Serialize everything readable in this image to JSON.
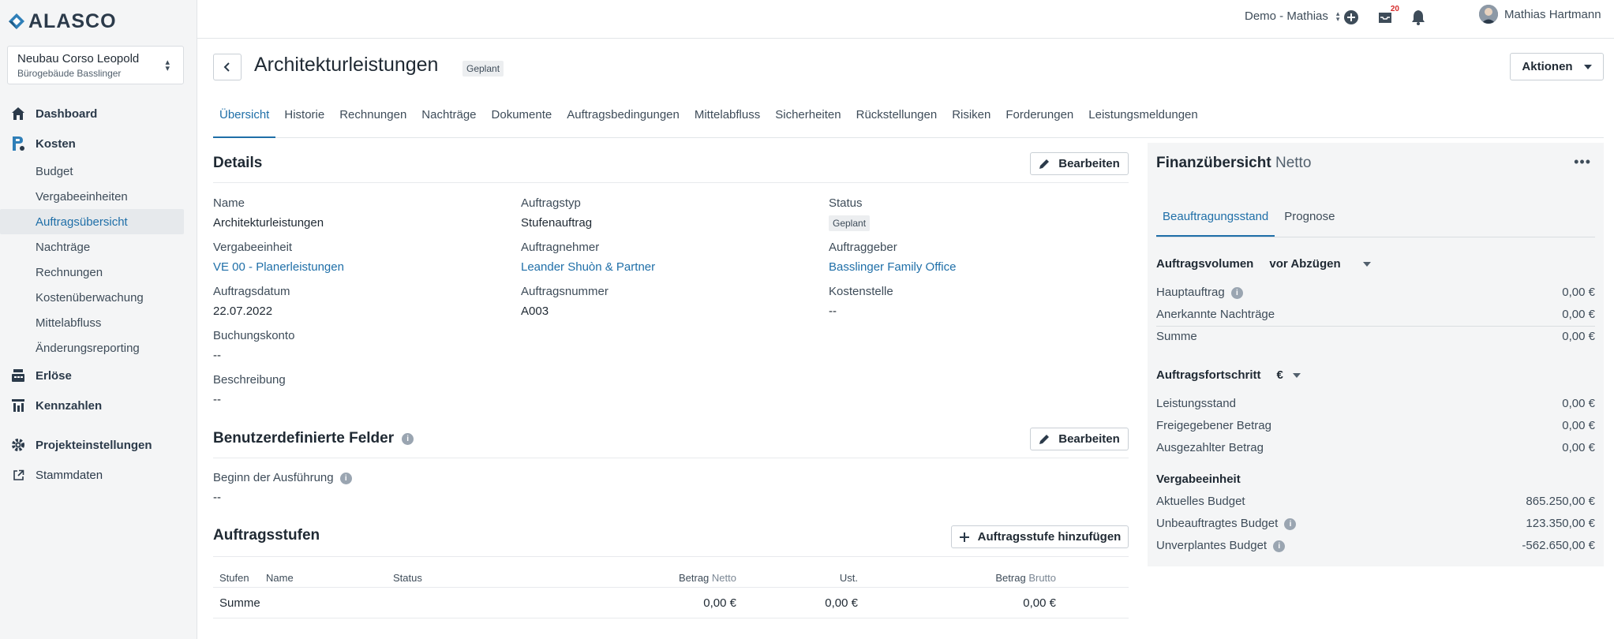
{
  "brand": {
    "name": "ALASCO"
  },
  "project": {
    "name": "Neubau Corso Leopold",
    "sub": "Bürogebäude Basslinger"
  },
  "nav": {
    "dashboard": "Dashboard",
    "kosten": "Kosten",
    "kosten_items": [
      "Budget",
      "Vergabeeinheiten",
      "Auftragsübersicht",
      "Nachträge",
      "Rechnungen",
      "Kostenüberwachung",
      "Mittelabfluss",
      "Änderungsreporting"
    ],
    "erloese": "Erlöse",
    "kennzahlen": "Kennzahlen",
    "projekteinstellungen": "Projekteinstellungen",
    "stammdaten": "Stammdaten"
  },
  "topbar": {
    "demo": "Demo - Mathias",
    "notifications_count": "20",
    "user_name": "Mathias Hartmann"
  },
  "header": {
    "title": "Architekturleistungen",
    "status_tag": "Geplant",
    "actions_label": "Aktionen"
  },
  "tabs": [
    "Übersicht",
    "Historie",
    "Rechnungen",
    "Nachträge",
    "Dokumente",
    "Auftragsbedingungen",
    "Mittelabfluss",
    "Sicherheiten",
    "Rückstellungen",
    "Risiken",
    "Forderungen",
    "Leistungsmeldungen"
  ],
  "details": {
    "title": "Details",
    "edit_label": "Bearbeiten",
    "name_label": "Name",
    "name_value": "Architekturleistungen",
    "auftragstyp_label": "Auftragstyp",
    "auftragstyp_value": "Stufenauftrag",
    "status_label": "Status",
    "status_value": "Geplant",
    "vergabe_label": "Vergabeeinheit",
    "vergabe_value": "VE 00 - Planerleistungen",
    "auftragnehmer_label": "Auftragnehmer",
    "auftragnehmer_value": "Leander Shuòn & Partner",
    "auftraggeber_label": "Auftraggeber",
    "auftraggeber_value": "Basslinger Family Office",
    "datum_label": "Auftragsdatum",
    "datum_value": "22.07.2022",
    "nummer_label": "Auftragsnummer",
    "nummer_value": "A003",
    "kostenstelle_label": "Kostenstelle",
    "kostenstelle_value": "--",
    "buchung_label": "Buchungskonto",
    "buchung_value": "--",
    "beschreibung_label": "Beschreibung",
    "beschreibung_value": "--"
  },
  "custom_fields": {
    "title": "Benutzerdefinierte Felder",
    "edit_label": "Bearbeiten",
    "beginn_label": "Beginn der Ausführung",
    "beginn_value": "--"
  },
  "stufen": {
    "title": "Auftragsstufen",
    "add_label": "Auftragsstufe hinzufügen",
    "col_stufen": "Stufen",
    "col_name": "Name",
    "col_status": "Status",
    "col_betrag": "Betrag",
    "col_netto": "Netto",
    "col_ust": "Ust.",
    "col_brutto": "Brutto",
    "sum_label": "Summe",
    "sum_netto": "0,00 €",
    "sum_ust": "0,00 €",
    "sum_brutto": "0,00 €"
  },
  "finance": {
    "title": "Finanzübersicht",
    "title_sub": "Netto",
    "tab_1": "Beauftragungsstand",
    "tab_2": "Prognose",
    "volumen_label": "Auftragsvolumen",
    "volumen_select": "vor Abzügen",
    "hauptauftrag_label": "Hauptauftrag",
    "hauptauftrag_value": "0,00 €",
    "nachtraege_label": "Anerkannte Nachträge",
    "nachtraege_value": "0,00 €",
    "summe_label": "Summe",
    "summe_value": "0,00 €",
    "fortschritt_label": "Auftragsfortschritt",
    "fortschritt_select": "€",
    "leistungsstand_label": "Leistungsstand",
    "leistungsstand_value": "0,00 €",
    "freigegeben_label": "Freigegebener Betrag",
    "freigegeben_value": "0,00 €",
    "ausgezahlt_label": "Ausgezahlter Betrag",
    "ausgezahlt_value": "0,00 €",
    "vergabe_head": "Vergabeeinheit",
    "aktuell_label": "Aktuelles Budget",
    "aktuell_value": "865.250,00 €",
    "unbeauftragt_label": "Unbeauftragtes Budget",
    "unbeauftragt_value": "123.350,00 €",
    "unverplant_label": "Unverplantes Budget",
    "unverplant_value": "-562.650,00 €"
  }
}
